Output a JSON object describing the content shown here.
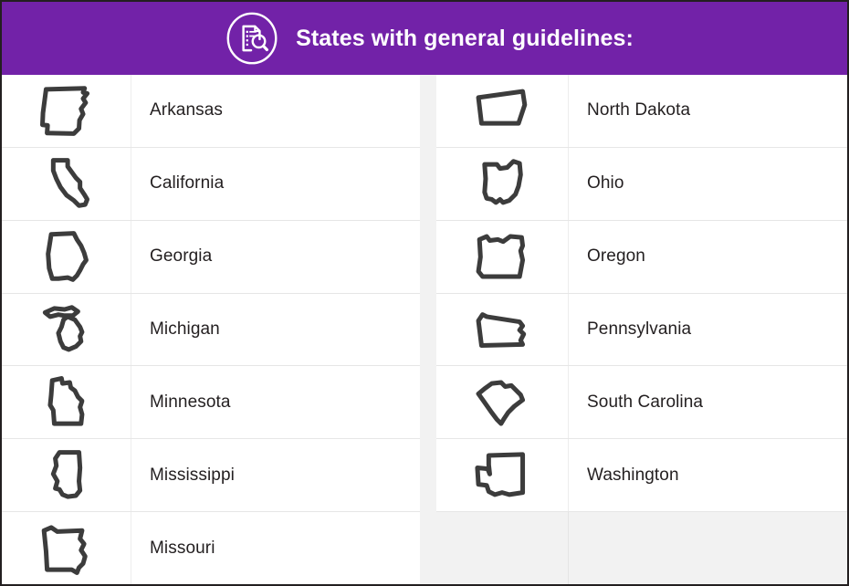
{
  "header": {
    "title": "States with general guidelines:",
    "icon": "document-search-icon",
    "background_color": "#7222a8",
    "text_color": "#ffffff"
  },
  "colors": {
    "header_purple": "#7222a8",
    "card_border": "#231f20",
    "row_divider": "#e6e6e6",
    "gutter_gray": "#f2f2f2",
    "empty_row_gray": "#f2f2f2",
    "shape_outline": "#3c3c3c",
    "text": "#231f20"
  },
  "columns": {
    "left": [
      {
        "name": "Arkansas",
        "icon": "state-outline-arkansas",
        "empty": false
      },
      {
        "name": "California",
        "icon": "state-outline-california",
        "empty": false
      },
      {
        "name": "Georgia",
        "icon": "state-outline-georgia",
        "empty": false
      },
      {
        "name": "Michigan",
        "icon": "state-outline-michigan",
        "empty": false
      },
      {
        "name": "Minnesota",
        "icon": "state-outline-minnesota",
        "empty": false
      },
      {
        "name": "Mississippi",
        "icon": "state-outline-mississippi",
        "empty": false
      },
      {
        "name": "Missouri",
        "icon": "state-outline-missouri",
        "empty": false
      }
    ],
    "right": [
      {
        "name": "North Dakota",
        "icon": "state-outline-north-dakota",
        "empty": false
      },
      {
        "name": "Ohio",
        "icon": "state-outline-ohio",
        "empty": false
      },
      {
        "name": "Oregon",
        "icon": "state-outline-oregon",
        "empty": false
      },
      {
        "name": "Pennsylvania",
        "icon": "state-outline-pennsylvania",
        "empty": false
      },
      {
        "name": "South Carolina",
        "icon": "state-outline-south-carolina",
        "empty": false
      },
      {
        "name": "Washington",
        "icon": "state-outline-washington",
        "empty": false
      },
      {
        "name": "",
        "icon": "",
        "empty": true
      }
    ]
  }
}
